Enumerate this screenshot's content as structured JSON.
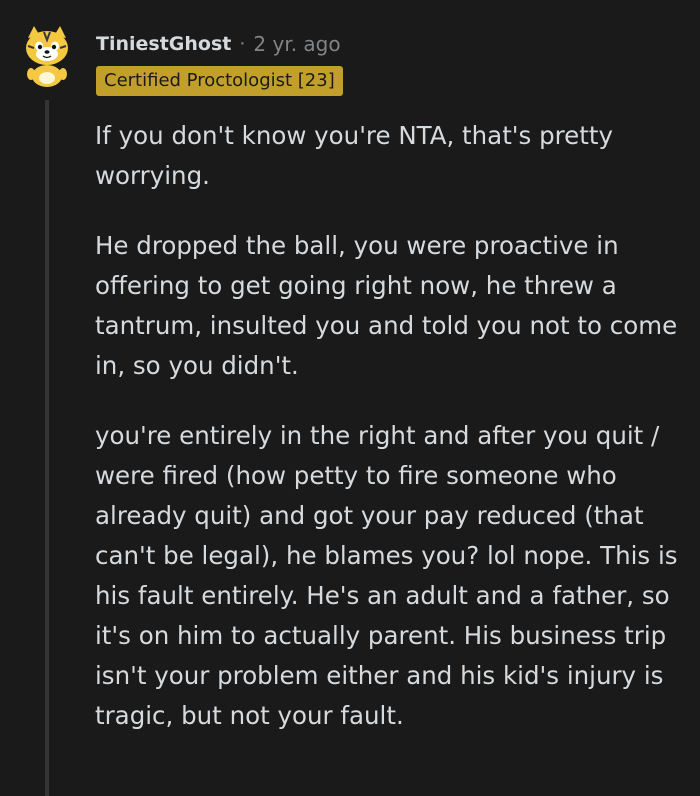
{
  "comment": {
    "author": "TiniestGhost",
    "separator": "·",
    "time": "2 yr. ago",
    "flair": "Certified Proctologist [23]",
    "paragraphs": [
      "If you don't know you're NTA, that's pretty worrying.",
      "He dropped the ball, you were proactive in offering to get going right now, he threw a tantrum, insulted you and told you not to come in, so you didn't.",
      "you're entirely in the right and after you quit / were fired (how petty to fire someone who already quit) and got your pay reduced (that can't be legal), he blames you? lol nope. This is his fault entirely. He's an adult and a father, so it's on him to actually parent. His business trip isn't your problem either and his kid's injury is tragic, but not your fault."
    ]
  },
  "colors": {
    "background": "#1a1a1b",
    "text": "#d7dadc",
    "meta": "#818384",
    "flair_bg": "#c29f2a",
    "thread_line": "#343536"
  }
}
